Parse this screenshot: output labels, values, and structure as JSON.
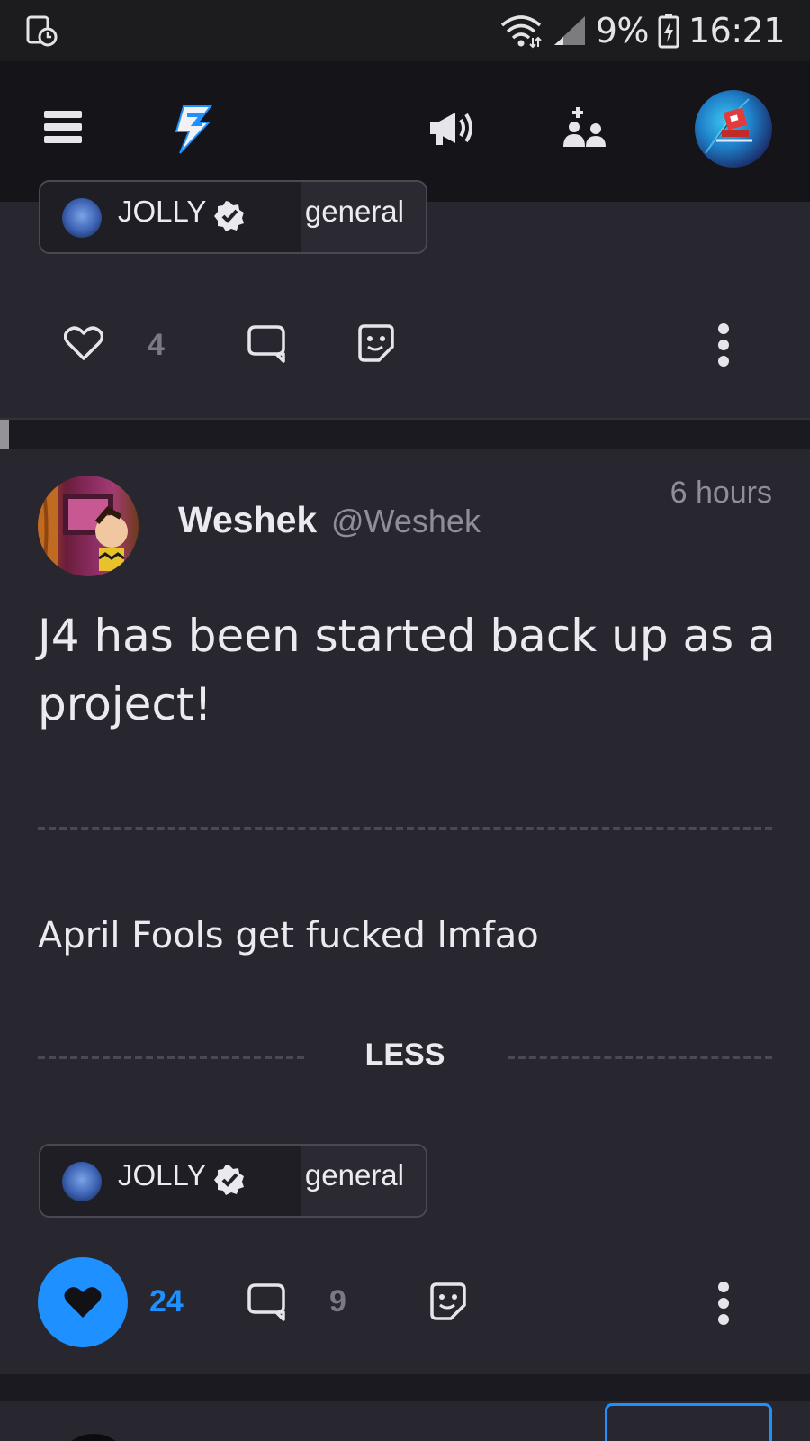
{
  "status_bar": {
    "battery": "9%",
    "time": "16:21",
    "icons": [
      "screen-record-icon",
      "wifi-icon",
      "signal-icon",
      "battery-charging-icon"
    ]
  },
  "top_nav": {
    "icons": [
      "hamburger-menu-icon",
      "lightning-logo-icon",
      "megaphone-icon",
      "people-plus-icon",
      "user-avatar"
    ]
  },
  "prev_post": {
    "community": {
      "name": "JOLLY",
      "channel": "general"
    },
    "actions": {
      "likes": "4"
    }
  },
  "post": {
    "author": {
      "name": "Weshek",
      "handle": "@Weshek"
    },
    "time": "6 hours",
    "title": "J4 has been started back up as a project!",
    "body": "April Fools get fucked lmfao",
    "less_label": "LESS",
    "community": {
      "name": "JOLLY",
      "channel": "general"
    },
    "actions": {
      "likes": "24",
      "comments": "9"
    },
    "colors": {
      "accent": "#1e90ff",
      "card": "#282730"
    }
  }
}
